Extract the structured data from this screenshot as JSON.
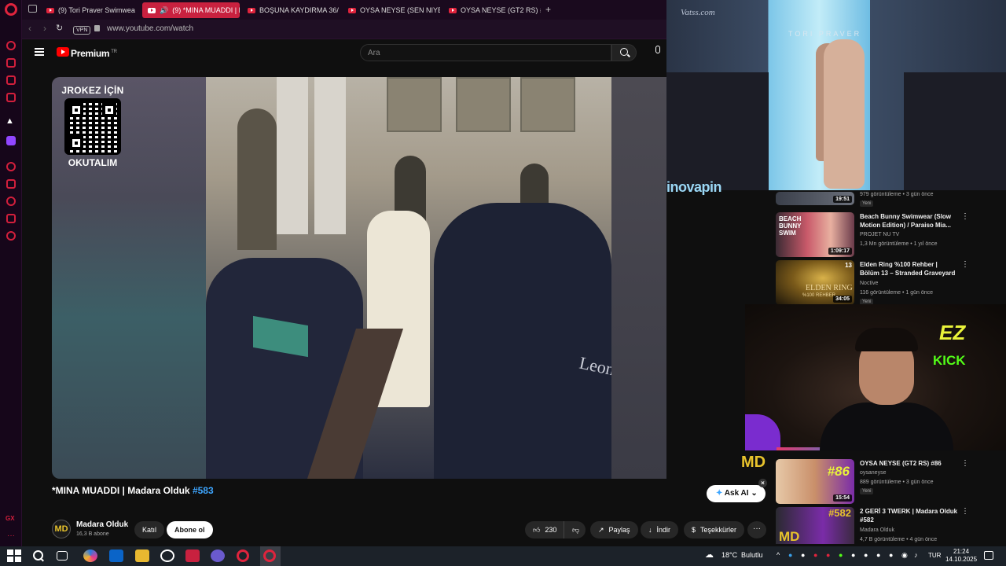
{
  "browser": {
    "tabs": [
      {
        "label": "(9) Tori Praver Swimwear",
        "active": false
      },
      {
        "label": "(9) *MINA MUADDI | M",
        "active": true
      },
      {
        "label": "BOŞUNA KAYDIRMA 36/",
        "active": false
      },
      {
        "label": "OYSA NEYSE (SEN NIYE",
        "active": false
      },
      {
        "label": "OYSA NEYSE (GT2 RS) #8",
        "active": false
      }
    ],
    "vpn_label": "VPN",
    "url": "www.youtube.com/watch"
  },
  "youtube": {
    "logo_label": "Premium",
    "country": "TR",
    "search_placeholder": "Ara"
  },
  "video": {
    "overlay_top": "JROKEZ İÇİN",
    "overlay_bottom": "OKUTALIM",
    "scene_text": "Leon",
    "watermark": "MD",
    "title_main": "*MINA MUADDI | Madara Olduk ",
    "title_tag": "#583",
    "ask_ai": "Ask AI",
    "channel_name": "Madara Olduk",
    "channel_subs": "16,3 B abone",
    "join_label": "Katıl",
    "subscribe_label": "Abone ol",
    "like_count": "230",
    "share_label": "Paylaş",
    "download_label": "İndir",
    "thanks_label": "Teşekkürler",
    "more_label": "···"
  },
  "overlays": {
    "runway_watermark": "Vatss.com",
    "runway_brand": "TORI PRAVER",
    "sponsor": "inovapin",
    "cam_neon_top": "EZ",
    "cam_neon_bottom": "KICK"
  },
  "recommendations": [
    {
      "title": "",
      "channel": "",
      "views": "979 görüntüleme • 3 gün önce",
      "badge": "Yeni",
      "duration": "19:51"
    },
    {
      "title": "Beach Bunny Swimwear (Slow Motion Edition) / Paraiso Mia...",
      "channel": "PROJET NU TV",
      "views": "1,3 Mn görüntüleme • 1 yıl önce",
      "badge": "",
      "duration": "1:09:17",
      "thumb_text": "BEACH BUNNY SWIM"
    },
    {
      "title": "Elden Ring %100 Rehber | Bölüm 13 – Stranded Graveyard",
      "channel": "Noctive",
      "views": "116 görüntüleme • 1 gün önce",
      "badge": "Yeni",
      "duration": "34:05",
      "thumb_text": "ELDEN RING",
      "thumb_num": "13",
      "thumb_sub": "%100 REHBER"
    },
    {
      "title": "OYSA NEYSE (GT2 RS) #86",
      "channel": "oysaneyse",
      "views": "889 görüntüleme • 3 gün önce",
      "badge": "Yeni",
      "duration": "15:54",
      "thumb_text": "#86"
    },
    {
      "title": "2 GERİ 3 TWERK | Madara Olduk #582",
      "channel": "Madara Olduk",
      "views": "4,7 B görüntüleme • 4 gün önce",
      "badge": "",
      "duration": "",
      "thumb_text": "#582"
    }
  ],
  "taskbar": {
    "temperature": "18°C",
    "weather": "Bulutlu",
    "language": "TUR",
    "time": "21:24",
    "date": "14.10.2025"
  },
  "colors": {
    "accent": "#c8213f",
    "link": "#3ea6ff",
    "kick_green": "#53fc18"
  }
}
